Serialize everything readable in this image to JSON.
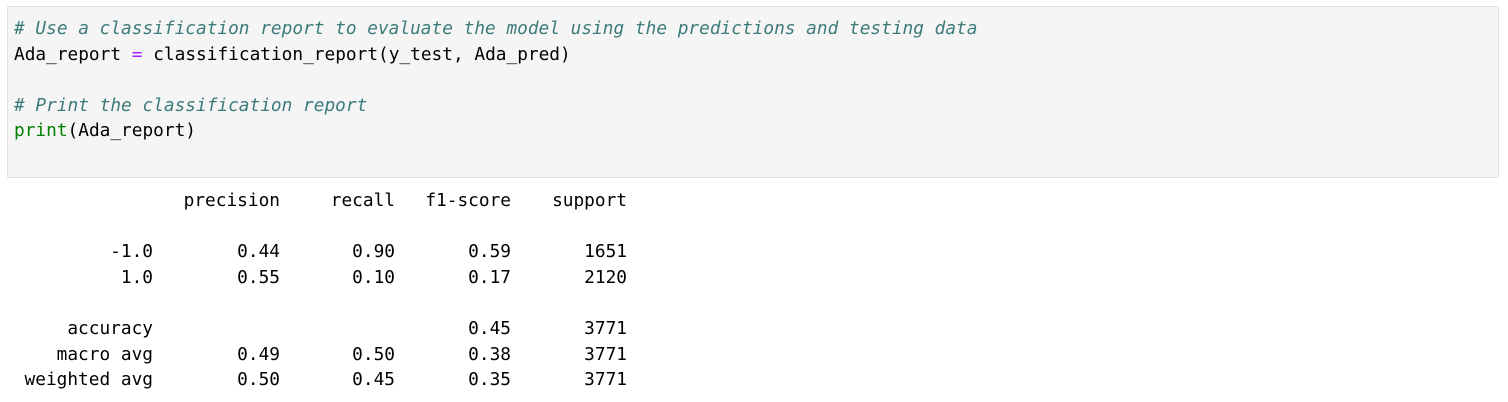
{
  "code_cell": {
    "comment_1": "# Use a classification report to evaluate the model using the predictions and testing data",
    "line_2_var": "Ada_report",
    "line_2_op": "=",
    "line_2_call": "classification_report(y_test, Ada_pred)",
    "comment_2": "# Print the classification report",
    "line_5_func": "print",
    "line_5_args": "(Ada_report)"
  },
  "output": {
    "headers": [
      "",
      "precision",
      "recall",
      "f1-score",
      "support"
    ],
    "class_rows": [
      {
        "label": "-1.0",
        "precision": "0.44",
        "recall": "0.90",
        "f1": "0.59",
        "support": "1651"
      },
      {
        "label": "1.0",
        "precision": "0.55",
        "recall": "0.10",
        "f1": "0.17",
        "support": "2120"
      }
    ],
    "summary_rows": [
      {
        "label": "accuracy",
        "precision": "",
        "recall": "",
        "f1": "0.45",
        "support": "3771"
      },
      {
        "label": "macro avg",
        "precision": "0.49",
        "recall": "0.50",
        "f1": "0.38",
        "support": "3771"
      },
      {
        "label": "weighted avg",
        "precision": "0.50",
        "recall": "0.45",
        "f1": "0.35",
        "support": "3771"
      }
    ]
  }
}
